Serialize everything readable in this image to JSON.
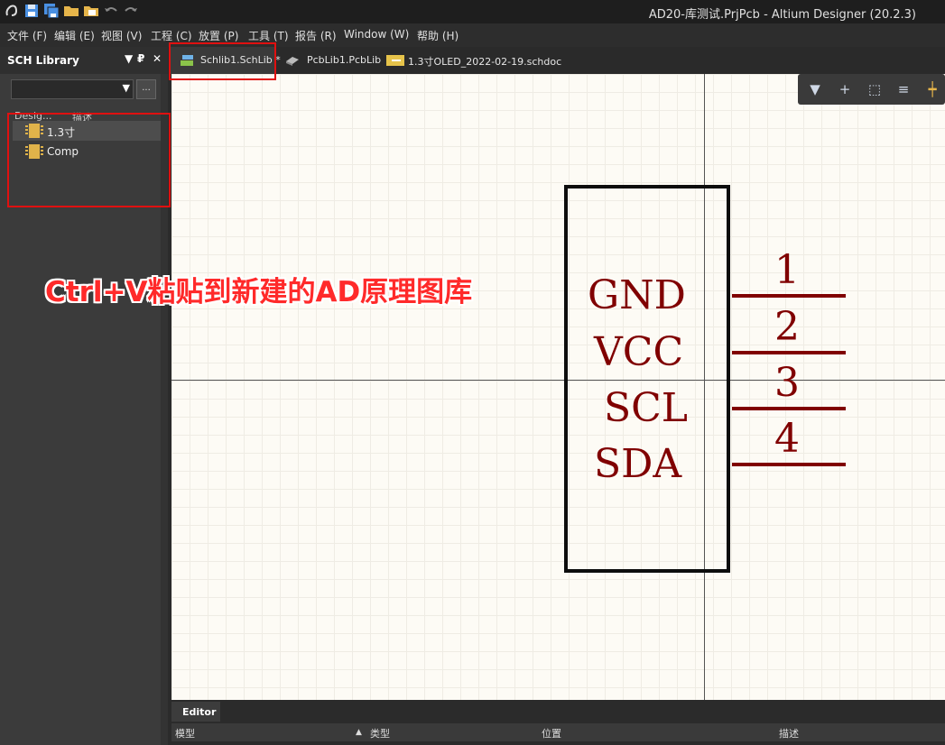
{
  "window": {
    "title": "AD20-库测试.PrjPcb - Altium Designer (20.2.3)"
  },
  "menu": [
    "文件 (F)",
    "编辑 (E)",
    "视图 (V)",
    "工程 (C)",
    "放置 (P)",
    "工具 (T)",
    "报告 (R)",
    "Window (W)",
    "帮助 (H)"
  ],
  "panel": {
    "title": "SCH Library",
    "columns": {
      "design": "Desig...",
      "desc": "描述"
    },
    "items": [
      {
        "label": "1.3寸",
        "selected": true
      },
      {
        "label": "Comp",
        "selected": false
      }
    ],
    "more_label": "..."
  },
  "tabs": [
    {
      "label": "Schlib1.SchLib *",
      "icon": "schlib-icon",
      "active": true
    },
    {
      "label": "PcbLib1.PcbLib",
      "icon": "pcblib-icon",
      "active": false
    },
    {
      "label": "1.3寸OLED_2022-02-19.schdoc",
      "icon": "schdoc-icon",
      "active": false
    }
  ],
  "annotation": "Ctrl+V粘贴到新建的AD原理图库",
  "component": {
    "pins": [
      {
        "name": "GND",
        "number": "1"
      },
      {
        "name": "VCC",
        "number": "2"
      },
      {
        "name": "SCL",
        "number": "3"
      },
      {
        "name": "SDA",
        "number": "4"
      }
    ],
    "pin_color": "#800000"
  },
  "editor": {
    "tab": "Editor",
    "columns": [
      "模型",
      "类型",
      "位置",
      "描述"
    ]
  },
  "colors": {
    "highlight": "#e01010",
    "canvas": "#fdfbf5"
  }
}
